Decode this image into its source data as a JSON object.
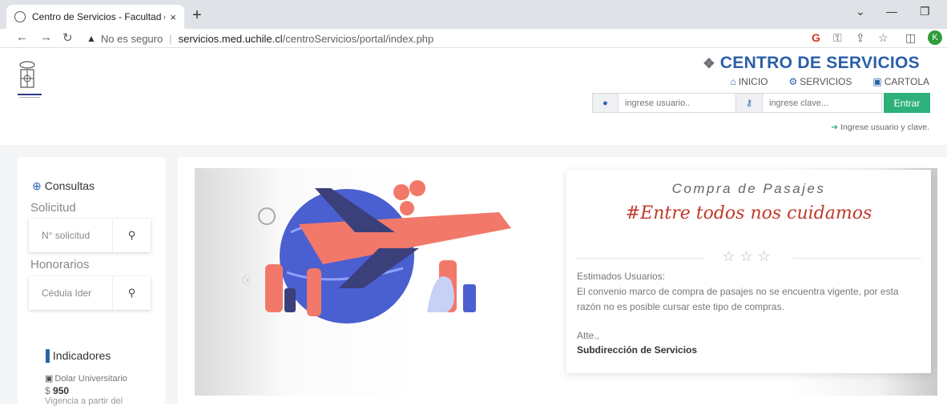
{
  "browser": {
    "tab_title": "Centro de Servicios - Facultad de",
    "tab_close": "×",
    "new_tab": "+",
    "security_label": "No es seguro",
    "url_host": "servicios.med.uchile.cl",
    "url_path": "/centroServicios/portal/index.php",
    "profile_initial": "K"
  },
  "header": {
    "brand": "CENTRO DE SERVICIOS",
    "nav": [
      {
        "label": "INICIO",
        "icon": "home-icon"
      },
      {
        "label": "SERVICIOS",
        "icon": "gears-icon"
      },
      {
        "label": "CARTOLA",
        "icon": "money-icon"
      }
    ],
    "login": {
      "user_placeholder": "ingrese usuario..",
      "pass_placeholder": "ingrese clave...",
      "submit_label": "Entrar",
      "hint": "Ingrese usuario y clave."
    }
  },
  "sidebar": {
    "title": "Consultas",
    "solicitud_label": "Solicitud",
    "solicitud_placeholder": "N° solicitud",
    "honorarios_label": "Honorarios",
    "honorarios_placeholder": "Cédula Ider",
    "indicadores_title": "Indicadores",
    "indicador_name": "Dolar Universitario",
    "indicador_currency": "$",
    "indicador_value": "950",
    "indicador_note": "Vigencia a partir del"
  },
  "slide": {
    "title": "Compra de Pasajes",
    "hashtag": "#Entre todos nos cuidamos",
    "greeting": "Estimados Usuarios:",
    "message": "El convenio marco de compra de pasajes no se encuentra vigente, por esta razón no es posible cursar este tipo de compras.",
    "closing": "Atte.,",
    "signature": "Subdirección de Servicios"
  },
  "colors": {
    "brand_blue": "#2b5fa8",
    "enter_green": "#2eb07a",
    "hashtag_red": "#c0392b",
    "plane_coral": "#f2786a",
    "globe_blue": "#4a5fd0"
  }
}
